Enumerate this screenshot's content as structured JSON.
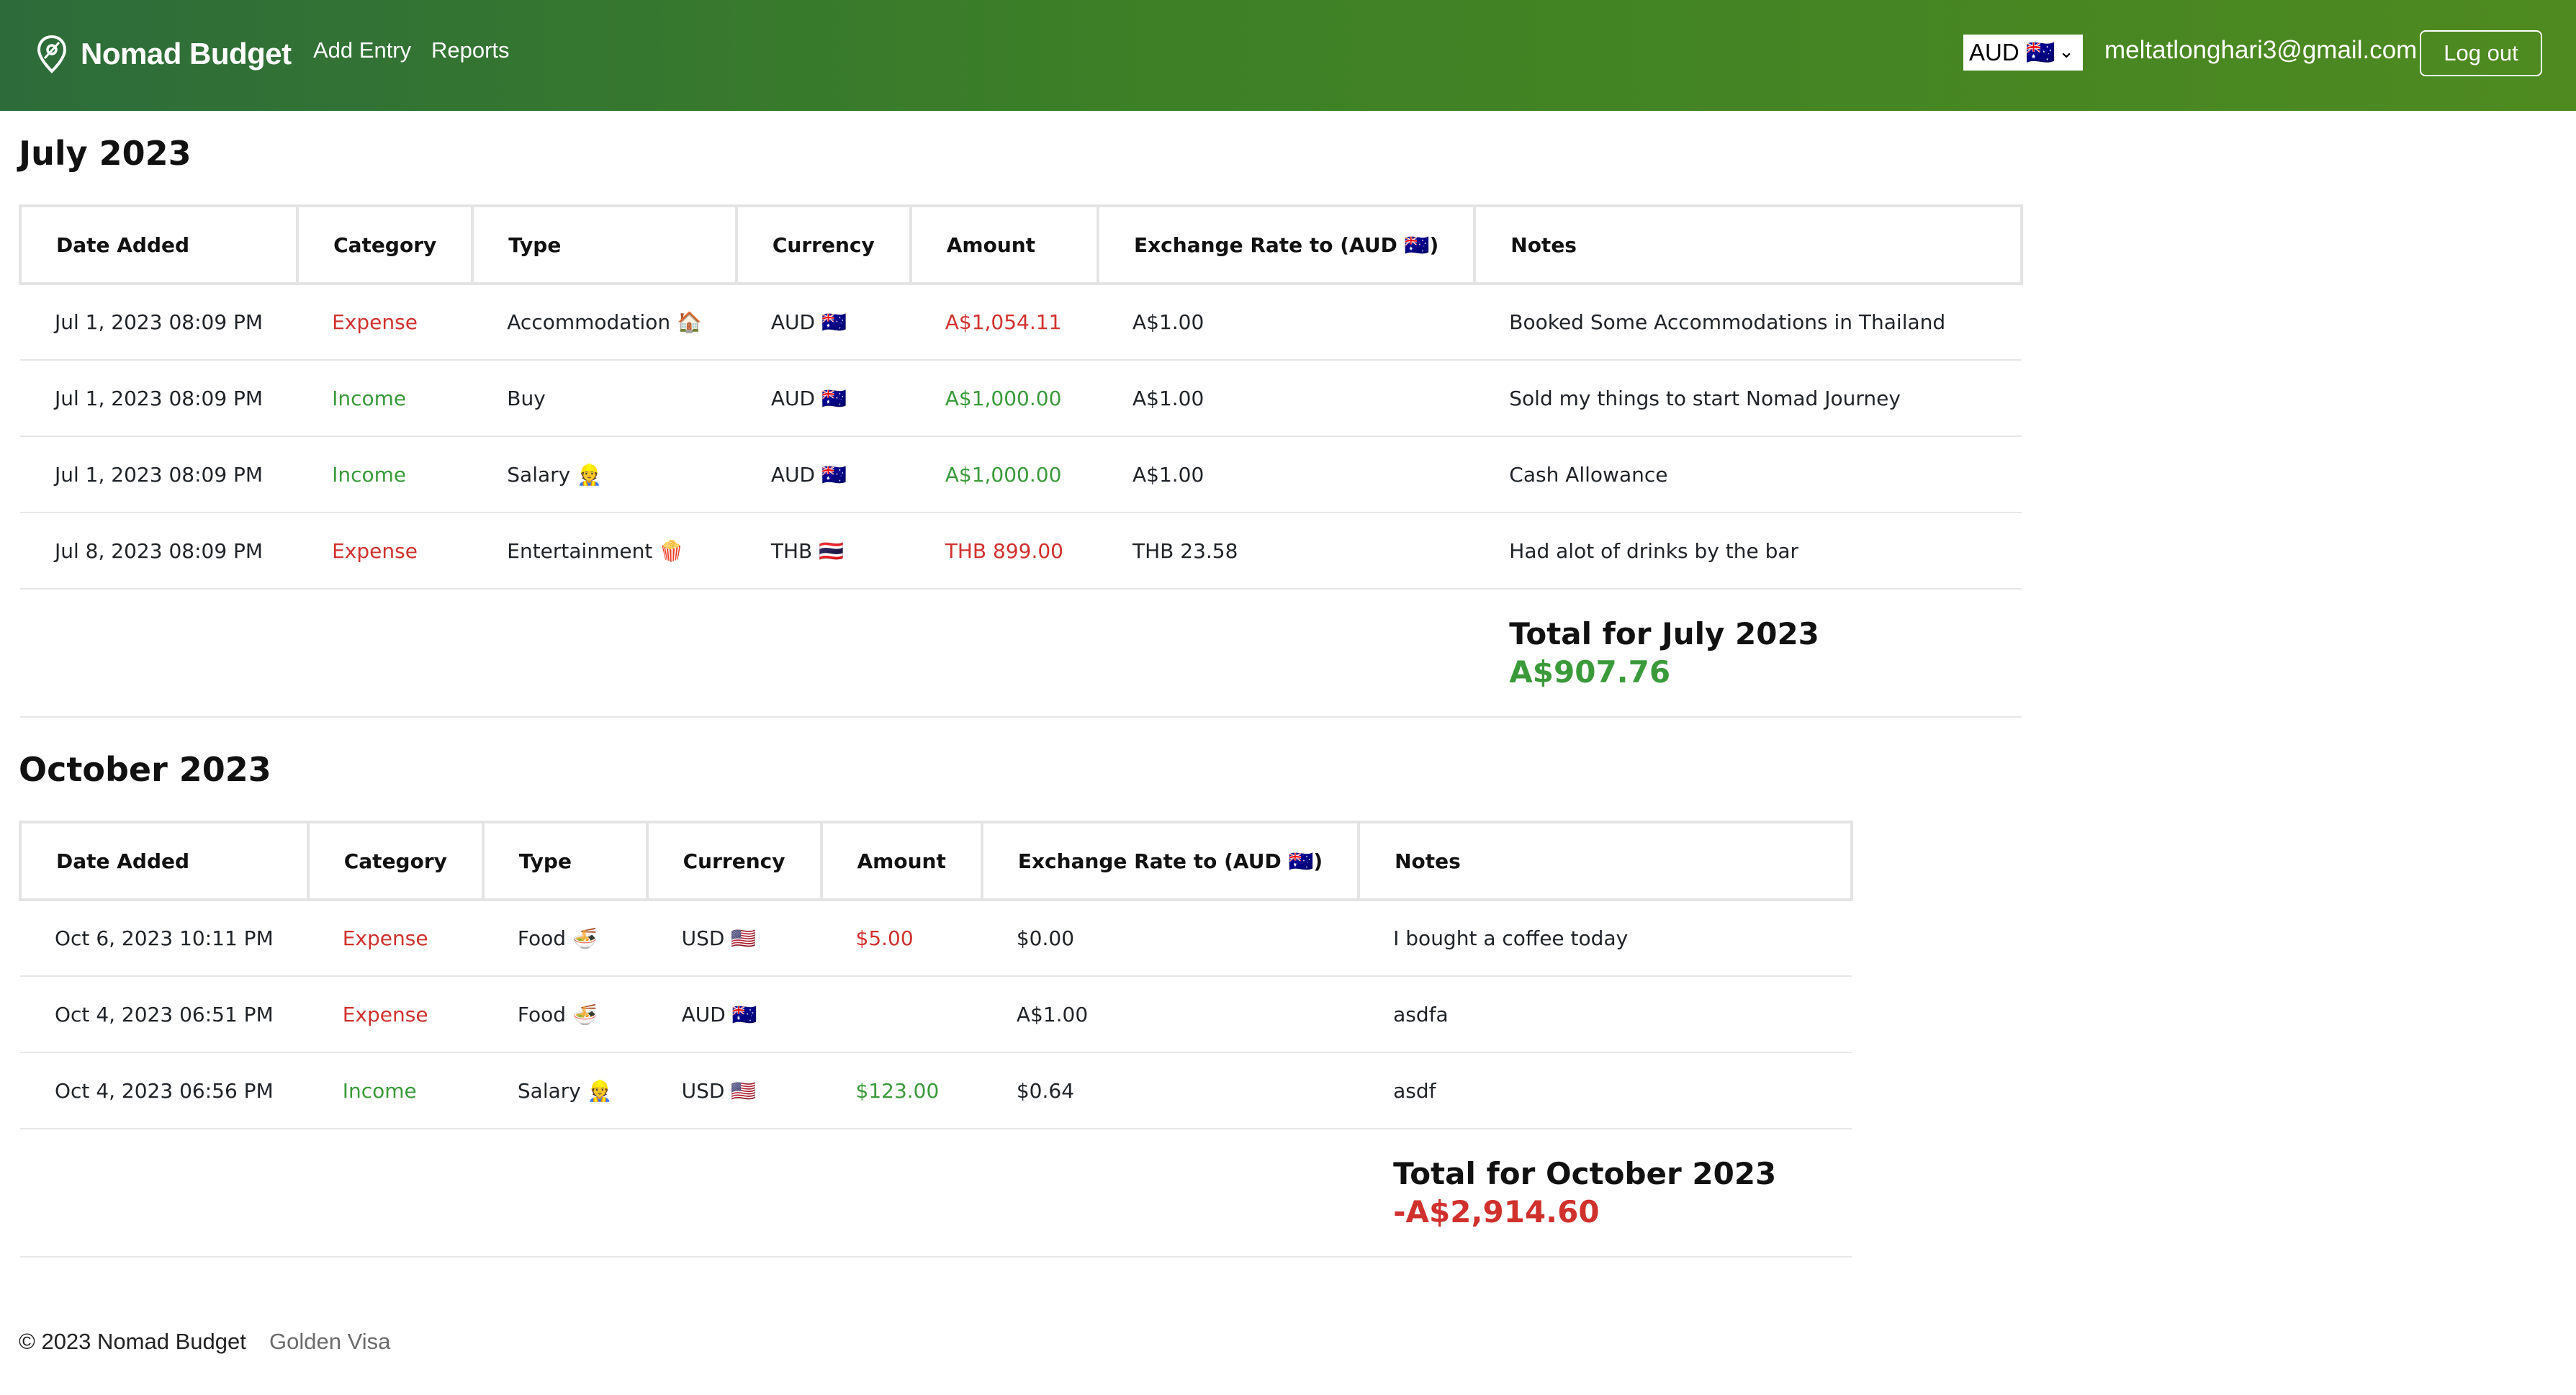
{
  "navbar": {
    "brand_name": "Nomad Budget",
    "links": [
      "Add Entry",
      "Reports"
    ],
    "currency_selected": "AUD 🇦🇺",
    "user_email": "meltatlonghari3@gmail.com",
    "logout_label": "Log out",
    "gradient_colors": [
      "#2d6c3a",
      "#4e8a20"
    ]
  },
  "columns": [
    "Date Added",
    "Category",
    "Type",
    "Currency",
    "Amount",
    "Exchange Rate to (AUD 🇦🇺)",
    "Notes"
  ],
  "months": [
    {
      "title": "July 2023",
      "rows": [
        {
          "date": "Jul 1, 2023 08:09 PM",
          "category": "Expense",
          "type": "Accommodation 🏠",
          "currency": "AUD 🇦🇺",
          "amount": "A$1,054.11",
          "rate": "A$1.00",
          "notes": "Booked Some Accommodations in Thailand"
        },
        {
          "date": "Jul 1, 2023 08:09 PM",
          "category": "Income",
          "type": "Buy",
          "currency": "AUD 🇦🇺",
          "amount": "A$1,000.00",
          "rate": "A$1.00",
          "notes": "Sold my things to start Nomad Journey"
        },
        {
          "date": "Jul 1, 2023 08:09 PM",
          "category": "Income",
          "type": "Salary 👷",
          "currency": "AUD 🇦🇺",
          "amount": "A$1,000.00",
          "rate": "A$1.00",
          "notes": "Cash Allowance"
        },
        {
          "date": "Jul 8, 2023 08:09 PM",
          "category": "Expense",
          "type": "Entertainment 🍿",
          "currency": "THB 🇹🇭",
          "amount": "THB 899.00",
          "rate": "THB 23.58",
          "notes": "Had alot of drinks by the bar"
        }
      ],
      "total_label": "Total for July 2023",
      "total_value": "A$907.76",
      "total_status": "income"
    },
    {
      "title": "October 2023",
      "rows": [
        {
          "date": "Oct 6, 2023 10:11 PM",
          "category": "Expense",
          "type": "Food 🍜",
          "currency": "USD 🇺🇸",
          "amount": "$5.00",
          "rate": "$0.00",
          "notes": "I bought a coffee today"
        },
        {
          "date": "Oct 4, 2023 06:51 PM",
          "category": "Expense",
          "type": "Food 🍜",
          "currency": "AUD 🇦🇺",
          "amount": "",
          "rate": "A$1.00",
          "notes": "asdfa"
        },
        {
          "date": "Oct 4, 2023 06:56 PM",
          "category": "Income",
          "type": "Salary 👷",
          "currency": "USD 🇺🇸",
          "amount": "$123.00",
          "rate": "$0.64",
          "notes": "asdf"
        }
      ],
      "total_label": "Total for October 2023",
      "total_value": "-A$2,914.60",
      "total_status": "expense"
    }
  ],
  "footer": {
    "copyright": "© 2023 Nomad Budget",
    "link": "Golden Visa"
  },
  "colors": {
    "expense": "#d0312d",
    "income": "#3a9a3a"
  }
}
